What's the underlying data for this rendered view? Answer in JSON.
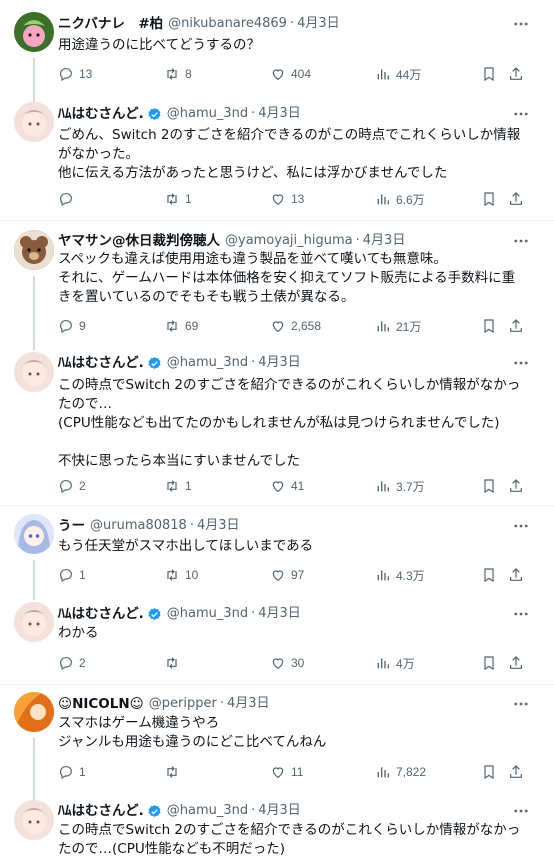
{
  "tweets": [
    {
      "name": "ニクバナレ　#柏",
      "verified": false,
      "handle": "@nikubanare4869",
      "time": "4月3日",
      "lines": [
        "用途違うのに比べてどうするの？"
      ],
      "reply_count": "13",
      "retweet_count": "8",
      "like_count": "404",
      "view_count": "44万",
      "avatar_color": "#6b8f3a"
    },
    {
      "name": "ﾊﾑはむさんど.",
      "verified": true,
      "handle": "@hamu_3nd",
      "time": "4月3日",
      "lines": [
        "ごめん、Switch 2のすごさを紹介できるのがこの時点でこれくらいしか情報",
        "がなかった。",
        "他に伝える方法があったと思うけど、私には浮かびませんでした"
      ],
      "reply_count": "",
      "retweet_count": "1",
      "like_count": "13",
      "view_count": "6.6万",
      "avatar_color": "#f1d9d2"
    },
    {
      "name": "ヤマサン@休日裁判傍聴人",
      "verified": false,
      "handle": "@yamoyaji_higuma",
      "time": "4月3日",
      "lines": [
        "スペックも違えば使用用途も違う製品を並べて嘆いても無意味。",
        "それに、ゲームハードは本体価格を安く抑えてソフト販売による手数料に重",
        "きを置いているのでそもそも戦う土俵が異なる。"
      ],
      "reply_count": "9",
      "retweet_count": "69",
      "like_count": "2,658",
      "view_count": "21万",
      "avatar_color": "#8a5a3c"
    },
    {
      "name": "ﾊﾑはむさんど.",
      "verified": true,
      "handle": "@hamu_3nd",
      "time": "4月3日",
      "lines": [
        "この時点でSwitch 2のすごさを紹介できるのがこれくらいしか情報がなかっ",
        "たので…",
        "(CPU性能なども出てたのかもしれませんが私は見つけられませんでした)",
        "",
        "不快に思ったら本当にすいませんでした"
      ],
      "reply_count": "2",
      "retweet_count": "1",
      "like_count": "41",
      "view_count": "3.7万",
      "avatar_color": "#f1d9d2"
    },
    {
      "name": "うー",
      "verified": false,
      "handle": "@uruma80818",
      "time": "4月3日",
      "lines": [
        "もう任天堂がスマホ出してほしいまである"
      ],
      "reply_count": "1",
      "retweet_count": "10",
      "like_count": "97",
      "view_count": "4.3万",
      "avatar_color": "#b9c6ea"
    },
    {
      "name": "ﾊﾑはむさんど.",
      "verified": true,
      "handle": "@hamu_3nd",
      "time": "4月3日",
      "lines": [
        "わかる"
      ],
      "reply_count": "2",
      "retweet_count": "",
      "like_count": "30",
      "view_count": "4万",
      "avatar_color": "#f1d9d2"
    },
    {
      "name": "☺NICOLN☺",
      "verified": false,
      "handle": "@peripper",
      "time": "4月3日",
      "lines": [
        "スマホはゲーム機違うやろ",
        "ジャンルも用途も違うのにどこ比べてんねん"
      ],
      "reply_count": "1",
      "retweet_count": "",
      "like_count": "11",
      "view_count": "7,822",
      "avatar_color": "#f08a24"
    },
    {
      "name": "ﾊﾑはむさんど.",
      "verified": true,
      "handle": "@hamu_3nd",
      "time": "4月3日",
      "lines": [
        "この時点でSwitch 2のすごさを紹介できるのがこれくらいしか情報がなかっ",
        "たので…(CPU性能なども不明だった)"
      ],
      "reply_count": "",
      "retweet_count": "",
      "like_count": "",
      "view_count": "",
      "avatar_color": "#f1d9d2"
    }
  ],
  "colors": {
    "text": "#0f1419",
    "muted": "#536471",
    "verified": "#1d9bf0",
    "divider": "#eff3f4",
    "thread_line": "#cfd9de"
  },
  "icons": {
    "more": "more-dots-icon",
    "reply": "reply-icon",
    "retweet": "retweet-icon",
    "like": "heart-icon",
    "views": "views-chart-icon",
    "bookmark": "bookmark-icon",
    "share": "share-icon",
    "verified": "verified-badge-icon"
  }
}
